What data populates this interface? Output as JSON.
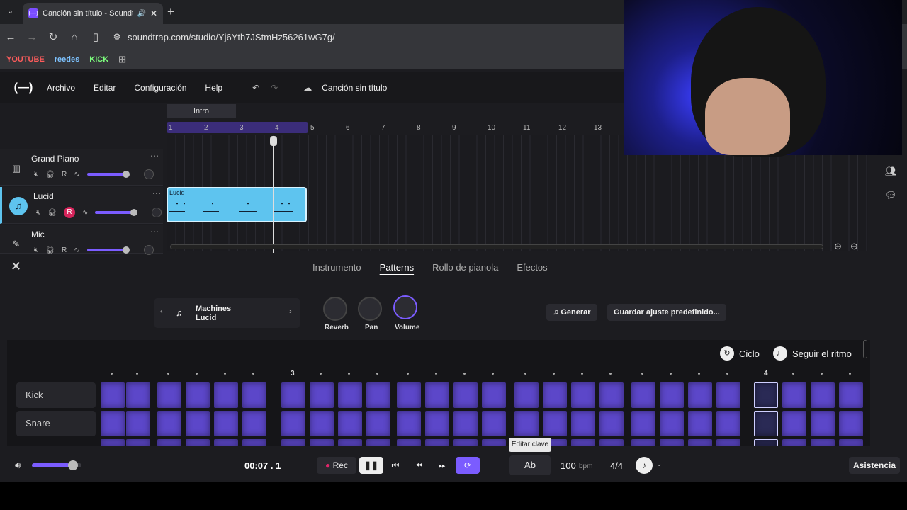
{
  "browser": {
    "tab_title": "Canción sin título - Soundtrap",
    "url": "soundtrap.com/studio/Yj6Yth7JStmHz56261wG7g/",
    "bookmarks": [
      "YOUTUBE",
      "reedes",
      "KICK"
    ],
    "bookmark_colors": [
      "#ff5c5c",
      "#7ec3ff",
      "#7dff7d"
    ]
  },
  "menubar": {
    "logo": "(—)",
    "items": [
      "Archivo",
      "Editar",
      "Configuración",
      "Help"
    ],
    "song_title": "Canción sin título"
  },
  "timeline": {
    "section_label": "Intro",
    "bar_numbers": [
      "1",
      "2",
      "3",
      "4",
      "5",
      "6",
      "7",
      "8",
      "9",
      "10",
      "11",
      "12",
      "13"
    ]
  },
  "tracks": [
    {
      "name": "Grand Piano",
      "icon": "piano-icon",
      "rec_active": false
    },
    {
      "name": "Lucid",
      "icon": "drum-machine-icon",
      "rec_active": true
    },
    {
      "name": "Mic",
      "icon": "mic-icon",
      "rec_active": false
    }
  ],
  "track_controls": {
    "rec_label": "R"
  },
  "clip": {
    "label": "Lucid"
  },
  "editor": {
    "tabs": [
      "Instrumento",
      "Patterns",
      "Rollo de pianola",
      "Efectos"
    ],
    "active_tab": "Patterns",
    "preset_line1": "Machines",
    "preset_line2": "Lucid",
    "knobs": [
      "Reverb",
      "Pan",
      "Volume"
    ],
    "generate_label": "Generar",
    "save_preset_label": "Guardar ajuste predefinido...",
    "cycle_label": "Ciclo",
    "follow_label": "Seguir el ritmo",
    "beat_labels": [
      "3",
      "4"
    ],
    "rows": [
      "Kick",
      "Snare"
    ]
  },
  "transport": {
    "time": "00:07 . 1",
    "rec_label": "Rec",
    "key": "Ab",
    "bpm": "100",
    "bpm_unit": "bpm",
    "signature": "4/4",
    "assist_label": "Asistencia",
    "key_tooltip": "Editar clave",
    "master_volume": 0.75
  },
  "colors": {
    "accent": "#7b5cff",
    "pad": "#5c47c9",
    "clip": "#5ec4ef"
  }
}
